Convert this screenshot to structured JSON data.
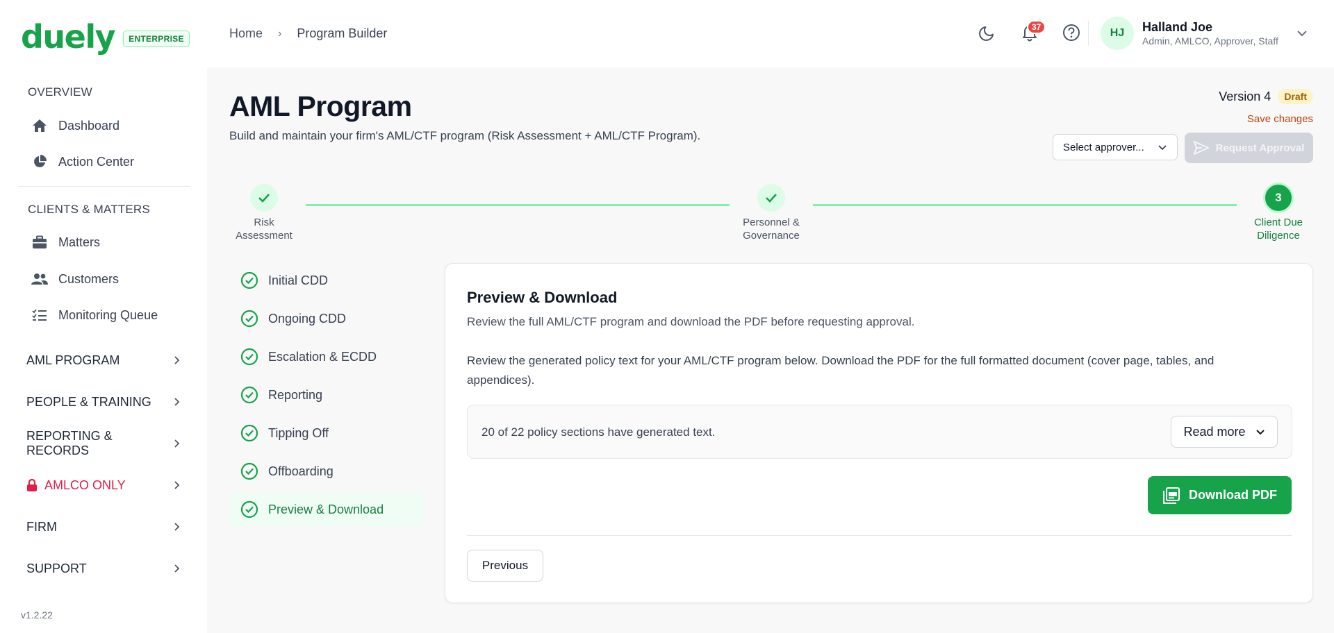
{
  "brand": {
    "logo": "duely",
    "badge": "ENTERPRISE",
    "accent": "#16a34a"
  },
  "sidebar": {
    "overview_heading": "OVERVIEW",
    "overview_items": [
      {
        "label": "Dashboard",
        "icon": "home-icon"
      },
      {
        "label": "Action Center",
        "icon": "pie-chart-icon"
      }
    ],
    "clients_heading": "CLIENTS & MATTERS",
    "clients_items": [
      {
        "label": "Matters",
        "icon": "briefcase-icon"
      },
      {
        "label": "Customers",
        "icon": "users-icon"
      },
      {
        "label": "Monitoring Queue",
        "icon": "list-check-icon"
      }
    ],
    "groups": [
      {
        "label": "AML PROGRAM"
      },
      {
        "label": "PEOPLE & TRAINING"
      },
      {
        "label": "REPORTING & RECORDS"
      },
      {
        "label": "AMLCO ONLY",
        "icon": "lock-icon",
        "color": "#e11d48"
      },
      {
        "label": "FIRM"
      },
      {
        "label": "SUPPORT"
      }
    ],
    "version": "v1.2.22"
  },
  "header": {
    "breadcrumb": {
      "home": "Home",
      "separator": "›",
      "current": "Program Builder"
    },
    "notifications_count": "37",
    "user": {
      "initials": "HJ",
      "name": "Halland Joe",
      "roles": "Admin, AMLCO, Approver, Staff"
    }
  },
  "page": {
    "title": "AML Program",
    "subtitle": "Build and maintain your firm's AML/CTF program (Risk Assessment + AML/CTF Program).",
    "version_label": "Version 4",
    "status_badge": "Draft",
    "save_link": "Save changes",
    "approver_placeholder": "Select approver...",
    "request_button": "Request Approval"
  },
  "stepper": [
    {
      "label_line1": "Risk",
      "label_line2": "Assessment",
      "state": "done"
    },
    {
      "label_line1": "Personnel &",
      "label_line2": "Governance",
      "state": "done"
    },
    {
      "number": "3",
      "label_line1": "Client Due",
      "label_line2": "Diligence",
      "state": "active"
    }
  ],
  "subnav": [
    {
      "label": "Initial CDD"
    },
    {
      "label": "Ongoing CDD"
    },
    {
      "label": "Escalation & ECDD"
    },
    {
      "label": "Reporting"
    },
    {
      "label": "Tipping Off"
    },
    {
      "label": "Offboarding"
    },
    {
      "label": "Preview & Download",
      "active": true
    }
  ],
  "card": {
    "title": "Preview & Download",
    "subtitle": "Review the full AML/CTF program and download the PDF before requesting approval.",
    "body": "Review the generated policy text for your AML/CTF program below. Download the PDF for the full formatted document (cover page, tables, and appendices).",
    "status": "20 of 22 policy sections have generated text.",
    "read_more": "Read more",
    "download_button": "Download PDF",
    "previous_button": "Previous"
  }
}
